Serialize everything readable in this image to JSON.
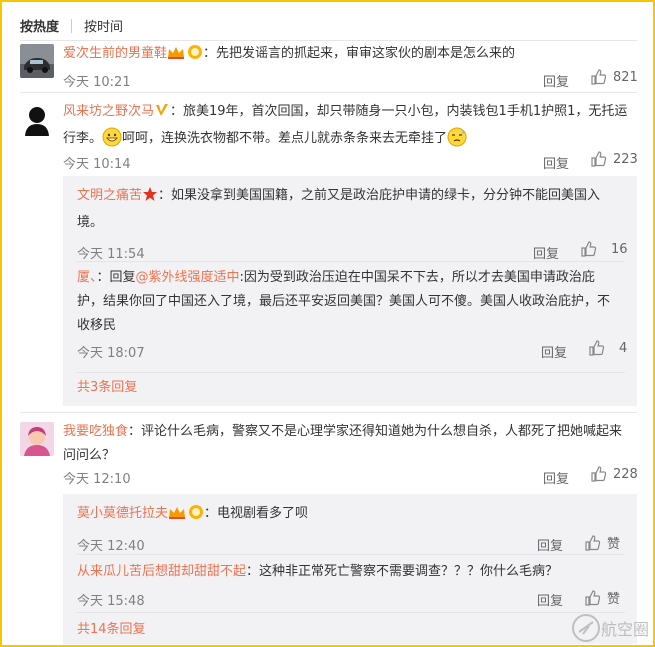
{
  "sort": {
    "hot": "按热度",
    "time": "按时间"
  },
  "comments": [
    {
      "user": "爱次生前的男童鞋",
      "text": "：先把发谣言的抓起来，审审这家伙的剧本是怎么来的",
      "time": "今天 10:21",
      "reply": "回复",
      "likes": "821"
    },
    {
      "user": "风来坊之野次马",
      "text1": "：旅美19年，首次回国，却只带随身一只小包，内装钱包1手机1护照1，无托运",
      "text2a": "行李。",
      "text2b": "呵呵，连换洗衣物都不带。差点儿就赤条条来去无牵挂了",
      "time": "今天 10:14",
      "reply": "回复",
      "likes": "223",
      "subs": [
        {
          "user": "文明之痛苦",
          "text1": "：如果没拿到美国国籍，之前又是政治庇护申请的绿卡，分分钟不能回美国入",
          "text2": "境。",
          "time": "今天 11:54",
          "reply": "回复",
          "likes": "16"
        },
        {
          "user": "厦、",
          "prefix": "：回复",
          "mention": "@紫外线强度适中",
          "text1": ":因为受到政治压迫在中国呆不下去，所以才去美国申请政治庇",
          "text2": "护，结果你回了中国还入了境，最后还平安返回美国？美国人可不傻。美国人收政治庇护，不",
          "text3": "收移民",
          "time": "今天 18:07",
          "reply": "回复",
          "likes": "4"
        }
      ],
      "more": "共3条回复"
    },
    {
      "user": "我要吃独食",
      "text1": "：评论什么毛病，警察又不是心理学家还得知道她为什么想自杀，人都死了把她喊起来",
      "text2": "问问么？",
      "time": "今天 12:10",
      "reply": "回复",
      "likes": "228",
      "subs": [
        {
          "user": "莫小莫德托拉夫",
          "text1": "：电视剧看多了呗",
          "time": "今天 12:40",
          "reply": "回复",
          "likes": "赞"
        },
        {
          "user": "从来瓜儿苦后想甜却甜甜不起",
          "text1": "：这种非正常死亡警察不需要调查？？？你什么毛病？",
          "time": "今天 15:48",
          "reply": "回复",
          "likes": "赞"
        }
      ],
      "more": "共14条回复"
    }
  ],
  "colors": {
    "username": "#eb7350",
    "frame": "#f6c600",
    "sub_bg": "#f2f2f5"
  },
  "watermark": "航空圈"
}
